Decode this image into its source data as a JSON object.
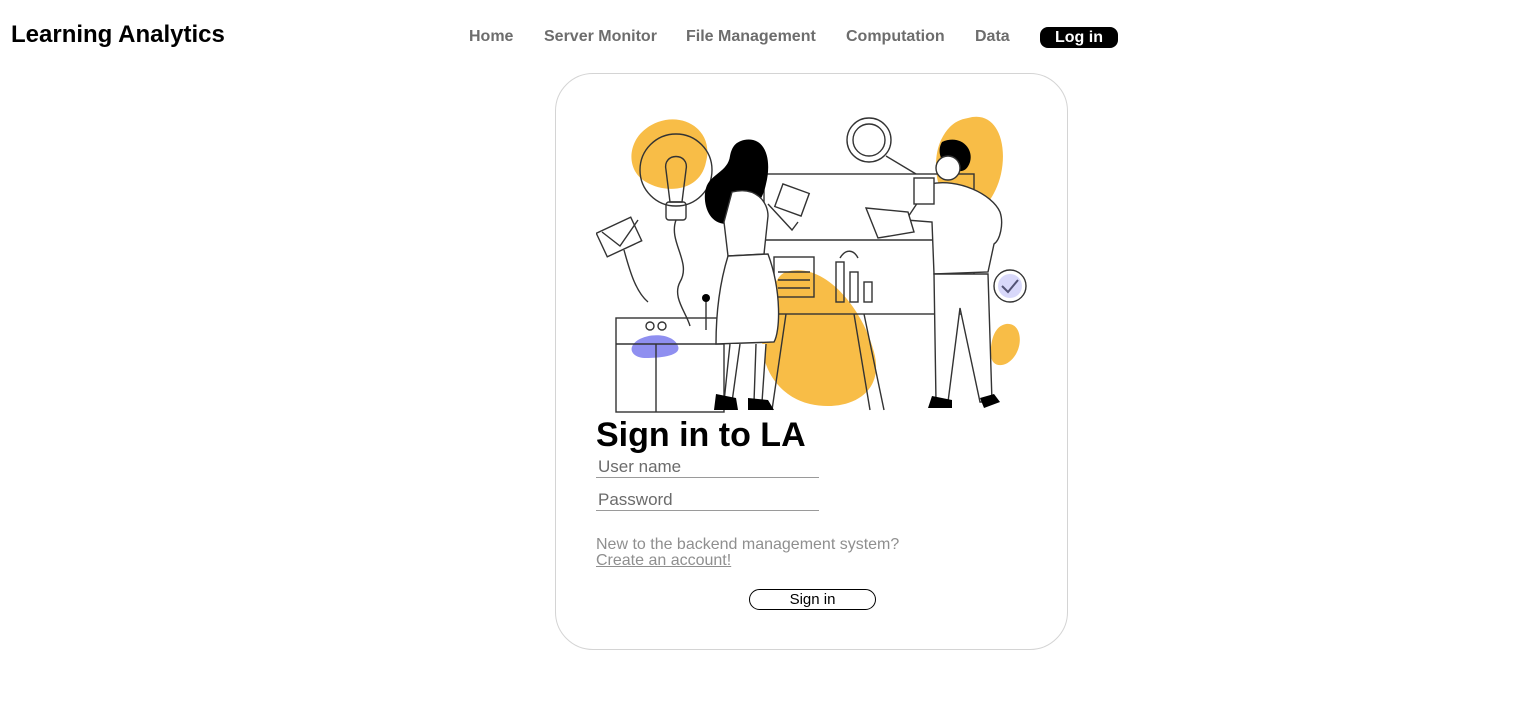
{
  "header": {
    "brand": "Learning Analytics",
    "nav": [
      "Home",
      "Server Monitor",
      "File Management",
      "Computation",
      "Data"
    ],
    "login_label": "Log in"
  },
  "signin": {
    "title": "Sign in to LA",
    "username_placeholder": "User name",
    "password_placeholder": "Password",
    "new_prompt": "New to the backend management system?",
    "create_link": "Create an account!",
    "submit_label": "Sign in"
  },
  "illustration": {
    "name": "team-collaboration-illustration",
    "accent_yellow": "#f8bd47",
    "accent_purple": "#8f8ff0"
  },
  "colors": {
    "nav_text": "#6d6d6d",
    "muted_text": "#8f8f8f",
    "card_border": "#d4d4d4"
  }
}
